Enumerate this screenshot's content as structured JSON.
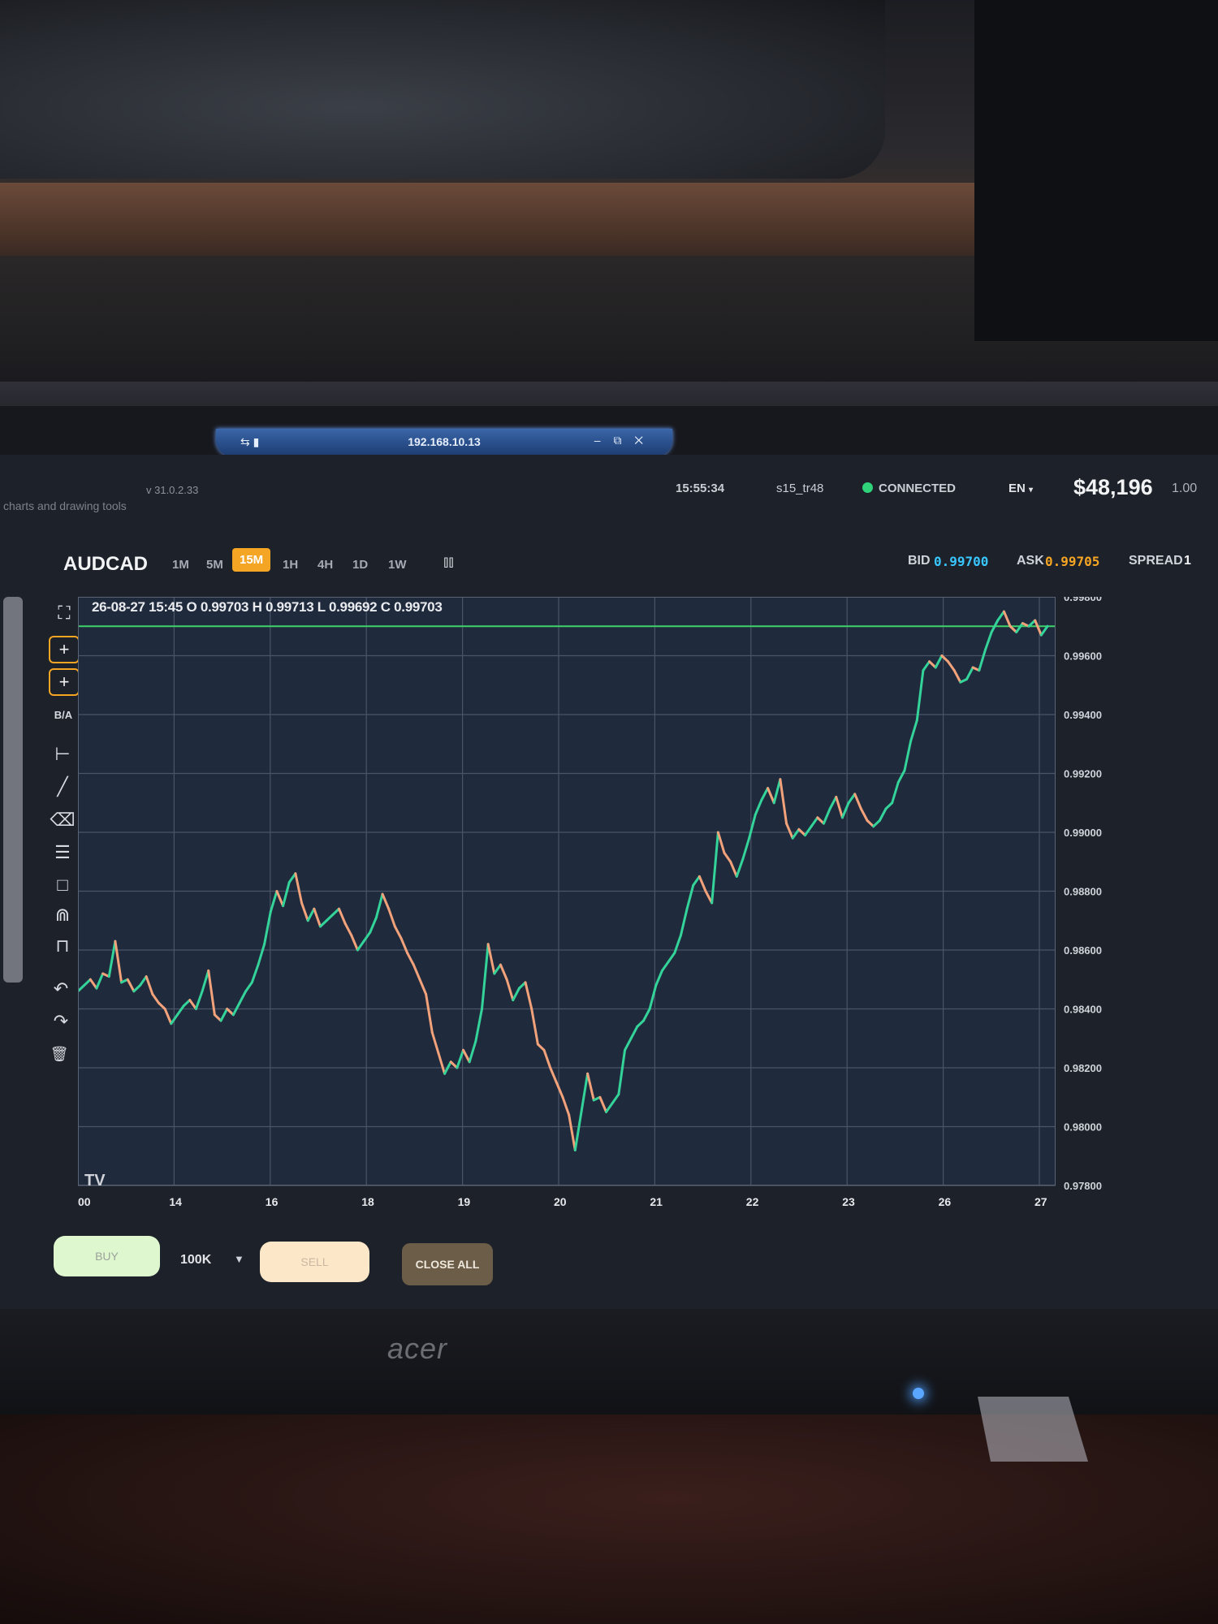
{
  "remote": {
    "title": "192.168.10.13",
    "signal_label": "⇆ ▮",
    "controls": "– ⧉ ✕"
  },
  "topbar": {
    "subtitle": "charts and drawing tools",
    "version": "v 31.0.2.33",
    "clock": "15:55:34",
    "user": "s15_tr48",
    "status": "CONNECTED",
    "language": "EN",
    "balance": "$48,196",
    "ratio": "1.00"
  },
  "symbolbar": {
    "symbol": "AUDCAD",
    "timeframes": [
      "1M",
      "5M",
      "15M",
      "1H",
      "4H",
      "1D",
      "1W"
    ],
    "active_timeframe": "15M",
    "bid_label": "BID",
    "bid": "0.99700",
    "ask_label": "ASK",
    "ask": "0.99705",
    "spread_label": "SPREAD",
    "spread": "1"
  },
  "ohlc_readout": "26-08-27 15:45 O 0.99703 H 0.99713 L 0.99692 C 0.99703",
  "tools": [
    "fullscreen-icon",
    "crosshair-icon",
    "crosshair-plus-icon",
    "ba-label",
    "ruler-icon",
    "trendline-icon",
    "eraser-icon",
    "fib-icon",
    "rectangle-icon",
    "magnet-icon",
    "lock-icon",
    "undo-icon",
    "redo-icon",
    "trash-icon"
  ],
  "tool_ba_label": "B/A",
  "watermark": "TV",
  "trade": {
    "buy_label": "BUY",
    "lot": "100K",
    "sell_label": "SELL",
    "close_all_label": "CLOSE ALL"
  },
  "colors": {
    "accent": "#f5a524",
    "bid": "#39c6ff",
    "ask": "#f5a524",
    "up": "#34d39a",
    "down": "#f2a27a",
    "price_line": "#3ed36a",
    "connected": "#2fd37a"
  },
  "chart_data": {
    "type": "line",
    "series": [
      {
        "values": [
          0.9846,
          0.9848,
          0.985,
          0.9847,
          0.9852,
          0.9851,
          0.9863,
          0.9849,
          0.985,
          0.9846,
          0.9848,
          0.9851,
          0.9845,
          0.9842,
          0.984,
          0.9835,
          0.9838,
          0.9841,
          0.9843,
          0.984,
          0.9846,
          0.9853,
          0.9838,
          0.9836,
          0.984,
          0.9838,
          0.9842,
          0.9846,
          0.9849,
          0.9855,
          0.9862,
          0.9873,
          0.988,
          0.9875,
          0.9883,
          0.9886,
          0.9876,
          0.987,
          0.9874,
          0.9868,
          0.987,
          0.9872,
          0.9874,
          0.9869,
          0.9865,
          0.986,
          0.9863,
          0.9866,
          0.9871,
          0.9879,
          0.9874,
          0.9868,
          0.9864,
          0.9859,
          0.9855,
          0.985,
          0.9845,
          0.9832,
          0.9825,
          0.9818,
          0.9822,
          0.982,
          0.9826,
          0.9822,
          0.9829,
          0.984,
          0.9862,
          0.9852,
          0.9855,
          0.985,
          0.9843,
          0.9847,
          0.9849,
          0.984,
          0.9828,
          0.9826,
          0.982,
          0.9815,
          0.981,
          0.9804,
          0.9792,
          0.9805,
          0.9818,
          0.9809,
          0.981,
          0.9805,
          0.9808,
          0.9811,
          0.9826,
          0.983,
          0.9834,
          0.9836,
          0.984,
          0.9848,
          0.9853,
          0.9856,
          0.9859,
          0.9865,
          0.9874,
          0.9882,
          0.9885,
          0.988,
          0.9876,
          0.99,
          0.9893,
          0.989,
          0.9885,
          0.9891,
          0.9898,
          0.9906,
          0.9911,
          0.9915,
          0.991,
          0.9918,
          0.9903,
          0.9898,
          0.9901,
          0.9899,
          0.9902,
          0.9905,
          0.9903,
          0.9908,
          0.9912,
          0.9905,
          0.991,
          0.9913,
          0.9908,
          0.9904,
          0.9902,
          0.9904,
          0.9908,
          0.991,
          0.9917,
          0.9921,
          0.9931,
          0.9938,
          0.9955,
          0.9958,
          0.9956,
          0.996,
          0.9958,
          0.9955,
          0.9951,
          0.9952,
          0.9956,
          0.9955,
          0.9962,
          0.9968,
          0.9972,
          0.9975,
          0.997,
          0.9968,
          0.9971,
          0.997,
          0.9972,
          0.9967,
          0.997
        ]
      }
    ],
    "x_ticks": [
      "00",
      "14",
      "16",
      "18",
      "19",
      "20",
      "21",
      "22",
      "23",
      "26",
      "27"
    ],
    "y_ticks": [
      "0.99800",
      "0.99600",
      "0.99400",
      "0.99200",
      "0.99000",
      "0.98800",
      "0.98600",
      "0.98400",
      "0.98200",
      "0.98000",
      "0.97800"
    ],
    "ylim": [
      0.978,
      0.998
    ],
    "price_line": 0.997,
    "grid": true
  }
}
